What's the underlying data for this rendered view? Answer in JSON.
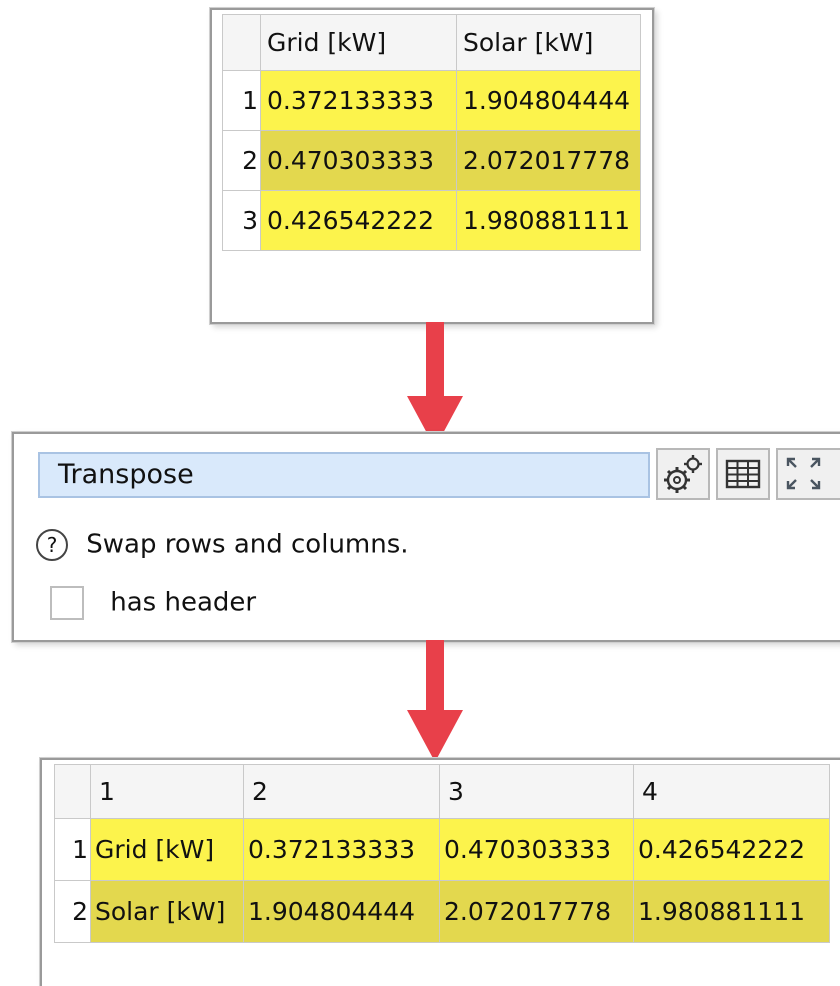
{
  "input_table": {
    "columns": [
      "Grid [kW]",
      "Solar [kW]"
    ],
    "rows": [
      {
        "index": "1",
        "cells": [
          "0.372133333",
          "1.904804444"
        ]
      },
      {
        "index": "2",
        "cells": [
          "0.470303333",
          "2.072017778"
        ]
      },
      {
        "index": "3",
        "cells": [
          "0.426542222",
          "1.980881111"
        ]
      }
    ]
  },
  "transform": {
    "title": "Transpose",
    "help_text": "Swap rows and columns.",
    "help_icon": "?",
    "has_header_label": "has header",
    "has_header_checked": false,
    "buttons": [
      "options-gear-icon",
      "table-view-icon",
      "maximize-icon"
    ]
  },
  "output_table": {
    "columns": [
      "1",
      "2",
      "3",
      "4"
    ],
    "rows": [
      {
        "index": "1",
        "cells": [
          "Grid [kW]",
          "0.372133333",
          "0.470303333",
          "0.426542222"
        ]
      },
      {
        "index": "2",
        "cells": [
          "Solar [kW]",
          "1.904804444",
          "2.072017778",
          "1.980881111"
        ]
      }
    ]
  },
  "colors": {
    "arrow": "#e8404a",
    "cell_yellow_light": "#fcf34c",
    "cell_yellow_dark": "#e3d84e",
    "title_bar": "#d9e9fb"
  }
}
